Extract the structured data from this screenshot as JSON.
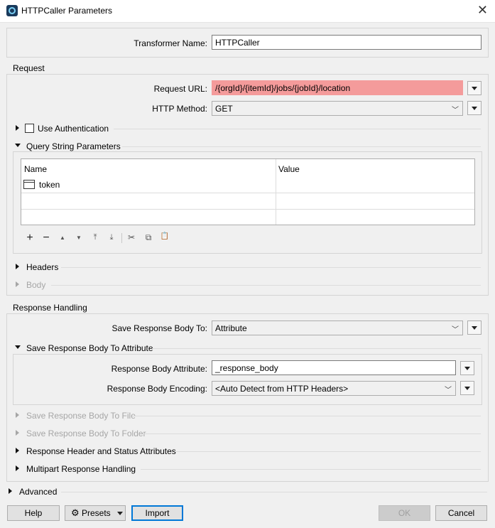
{
  "window": {
    "title": "HTTPCaller Parameters"
  },
  "transformer": {
    "label": "Transformer Name:",
    "value": "HTTPCaller"
  },
  "request": {
    "section_label": "Request",
    "url_label": "Request URL:",
    "url_value": "/{orgId}/{itemId}/jobs/{jobId}/location",
    "method_label": "HTTP Method:",
    "method_value": "GET",
    "use_auth_label": "Use Authentication",
    "query_label": "Query String Parameters",
    "table": {
      "columns": [
        "Name",
        "Value"
      ],
      "rows": [
        {
          "name": "token",
          "value": ""
        }
      ]
    },
    "headers_label": "Headers",
    "body_label": "Body"
  },
  "toolbar": {
    "add": "+",
    "remove": "−",
    "up": "▲",
    "down": "▼",
    "top": "⤒",
    "bottom": "⤓",
    "cut": "✂",
    "copy": "⧉",
    "paste": "📋"
  },
  "response": {
    "section_label": "Response Handling",
    "save_to_label": "Save Response Body To:",
    "save_to_value": "Attribute",
    "save_attr_section": "Save Response Body To Attribute",
    "body_attr_label": "Response Body Attribute:",
    "body_attr_value": "_response_body",
    "encoding_label": "Response Body Encoding:",
    "encoding_value": "<Auto Detect from HTTP Headers>",
    "save_file_label": "Save Response Body To File",
    "save_folder_label": "Save Response Body To Folder",
    "header_status_label": "Response Header and Status Attributes",
    "multipart_label": "Multipart Response Handling"
  },
  "advanced_label": "Advanced",
  "buttons": {
    "help": "Help",
    "presets": "Presets",
    "import": "Import",
    "ok": "OK",
    "cancel": "Cancel"
  },
  "colors": {
    "error_field": "#f49b9b",
    "focus_border": "#0078d7"
  }
}
